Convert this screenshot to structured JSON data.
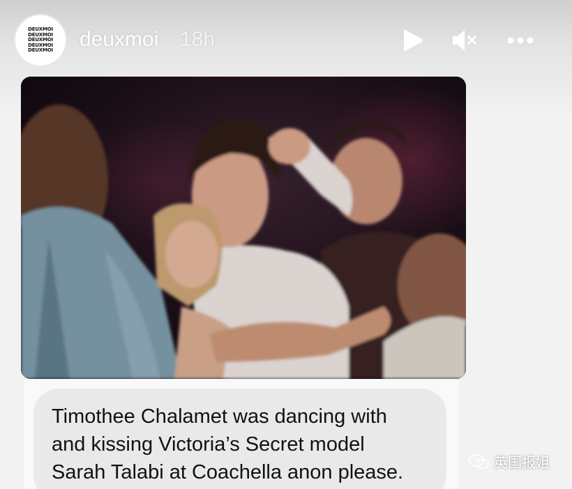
{
  "story": {
    "avatar": {
      "lines": [
        "DEUXMOI",
        "DEUXMOI",
        "DEUXMOI",
        "DEUXMOI",
        "DEUXMOI"
      ]
    },
    "username": "deuxmoi",
    "timestamp": "18h",
    "controls": {
      "play_icon": "play-icon",
      "mute_icon": "speaker-muted-icon",
      "more_icon": "more-dots-icon"
    }
  },
  "media": {
    "description_icon": "photo"
  },
  "caption": {
    "text": "Timothee Chalamet was dancing with\nand kissing Victoria’s Secret model\nSarah Talabi at Coachella anon please."
  },
  "watermark": {
    "text": "英国报姐",
    "icon": "wechat-icon"
  },
  "colors": {
    "background": "#f2f2f2",
    "caption_bubble": "#e9e9e9",
    "header_text": "#ffffff"
  }
}
